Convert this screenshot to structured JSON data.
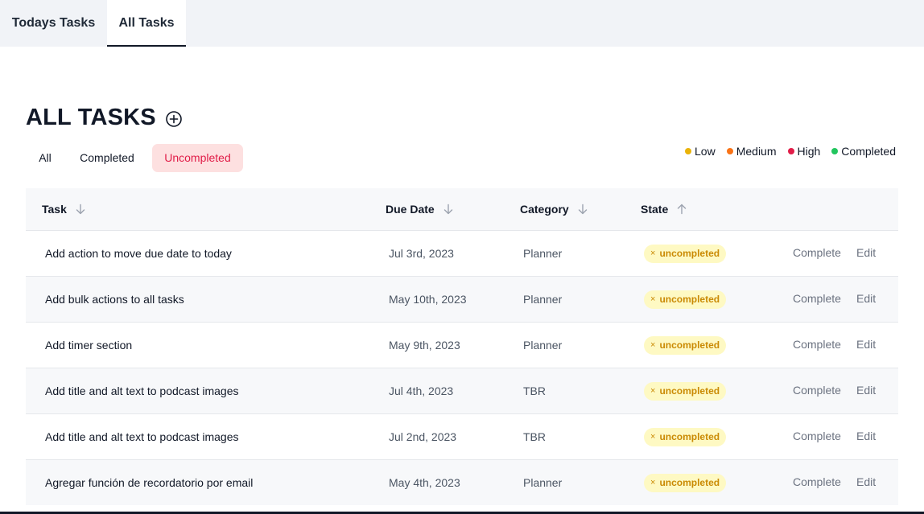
{
  "tabs": [
    {
      "label": "Todays Tasks"
    },
    {
      "label": "All Tasks"
    }
  ],
  "page": {
    "title": "ALL TASKS",
    "add_icon": "plus-circle-icon"
  },
  "filters": [
    {
      "label": "All"
    },
    {
      "label": "Completed"
    },
    {
      "label": "Uncompleted",
      "active": true
    }
  ],
  "legend": [
    {
      "label": "Low",
      "color": "#eab308"
    },
    {
      "label": "Medium",
      "color": "#f97316"
    },
    {
      "label": "High",
      "color": "#e11d48"
    },
    {
      "label": "Completed",
      "color": "#22c55e"
    }
  ],
  "table": {
    "columns": [
      {
        "label": "Task",
        "sort": "desc"
      },
      {
        "label": "Due Date",
        "sort": "desc"
      },
      {
        "label": "Category",
        "sort": "desc"
      },
      {
        "label": "State",
        "sort": "asc"
      }
    ],
    "rows": [
      {
        "task": "Add action to move due date to today",
        "due": "Jul 3rd, 2023",
        "category": "Planner",
        "state": "uncompleted",
        "complete": "Complete",
        "edit": "Edit"
      },
      {
        "task": "Add bulk actions to all tasks",
        "due": "May 10th, 2023",
        "category": "Planner",
        "state": "uncompleted",
        "complete": "Complete",
        "edit": "Edit"
      },
      {
        "task": "Add timer section",
        "due": "May 9th, 2023",
        "category": "Planner",
        "state": "uncompleted",
        "complete": "Complete",
        "edit": "Edit"
      },
      {
        "task": "Add title and alt text to podcast images",
        "due": "Jul 4th, 2023",
        "category": "TBR",
        "state": "uncompleted",
        "complete": "Complete",
        "edit": "Edit"
      },
      {
        "task": "Add title and alt text to podcast images",
        "due": "Jul 2nd, 2023",
        "category": "TBR",
        "state": "uncompleted",
        "complete": "Complete",
        "edit": "Edit"
      },
      {
        "task": "Agregar función de recordatorio por email",
        "due": "May 4th, 2023",
        "category": "Planner",
        "state": "uncompleted",
        "complete": "Complete",
        "edit": "Edit"
      }
    ],
    "state_mark": "×"
  }
}
